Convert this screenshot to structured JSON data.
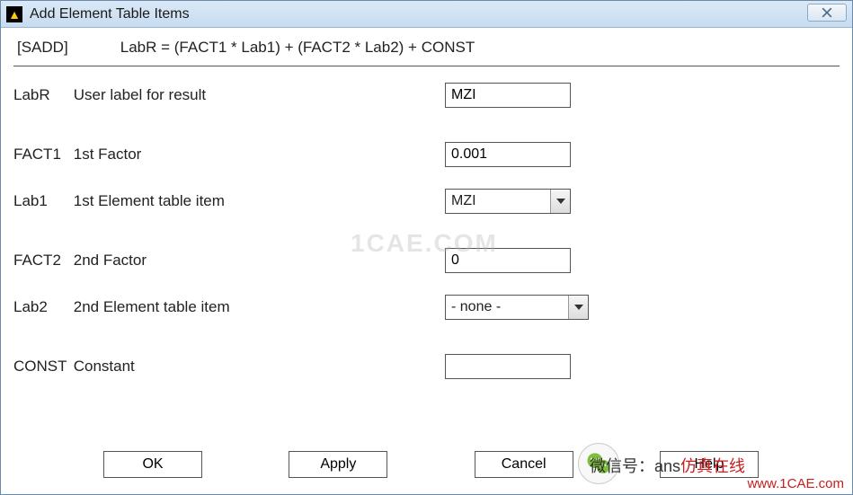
{
  "window": {
    "title": "Add Element Table Items",
    "close_glyph": "✕"
  },
  "formula": {
    "command": "[SADD]",
    "expr": "LabR = (FACT1 * Lab1) + (FACT2 * Lab2) + CONST"
  },
  "fields": {
    "labr": {
      "code": "LabR",
      "label": "User label for result",
      "value": "MZI"
    },
    "fact1": {
      "code": "FACT1",
      "label": "1st Factor",
      "value": "0.001"
    },
    "lab1": {
      "code": "Lab1",
      "label": "1st Element table item",
      "value": "MZI"
    },
    "fact2": {
      "code": "FACT2",
      "label": "2nd Factor",
      "value": "0"
    },
    "lab2": {
      "code": "Lab2",
      "label": "2nd Element table item",
      "value": "- none -"
    },
    "const": {
      "code": "CONST",
      "label": "Constant",
      "value": ""
    }
  },
  "buttons": {
    "ok": "OK",
    "apply": "Apply",
    "cancel": "Cancel",
    "help": "Help"
  },
  "watermark": "1CAE.COM",
  "overlay": {
    "text_prefix": "微信号：ans",
    "text_red": "仿真在线",
    "url": "www.1CAE.com"
  }
}
